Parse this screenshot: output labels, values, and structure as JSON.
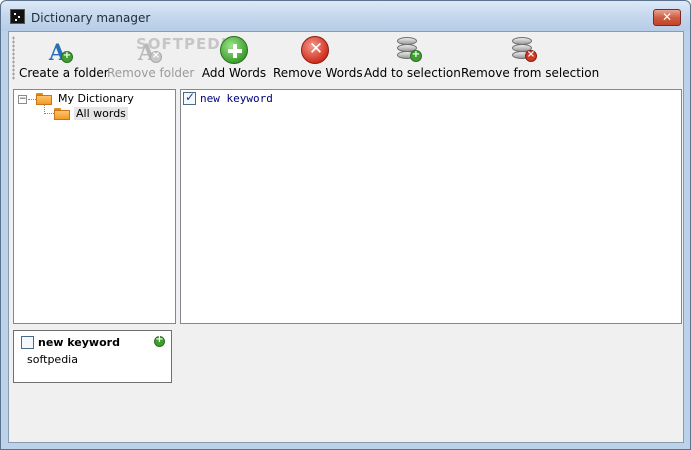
{
  "window": {
    "title": "Dictionary manager",
    "close_glyph": "✕"
  },
  "toolbar": {
    "buttons": [
      {
        "label": "Create a folder",
        "icon": "create-folder-icon",
        "enabled": true
      },
      {
        "label": "Remove folder",
        "icon": "remove-folder-icon",
        "enabled": false
      },
      {
        "label": "Add Words",
        "icon": "add-words-icon",
        "enabled": true
      },
      {
        "label": "Remove Words",
        "icon": "remove-words-icon",
        "enabled": true
      },
      {
        "label": "Add to selection",
        "icon": "add-to-selection-icon",
        "enabled": true
      },
      {
        "label": "Remove from selection",
        "icon": "remove-from-selection-icon",
        "enabled": true
      }
    ],
    "watermark": "SOFTPEDIA"
  },
  "tree": {
    "root": {
      "label": "My Dictionary",
      "expander": "−"
    },
    "child": {
      "label": "All words",
      "selected": true
    }
  },
  "words": [
    {
      "text": "new keyword",
      "checked": true
    }
  ],
  "card": {
    "title": "new keyword",
    "body": "softpedia",
    "checked": false,
    "add_glyph": "+"
  },
  "colors": {
    "title_bar": "#c3d6ec",
    "client_bg": "#f0f0f0",
    "keyword_text": "#00007f",
    "close_button": "#c2432a"
  }
}
